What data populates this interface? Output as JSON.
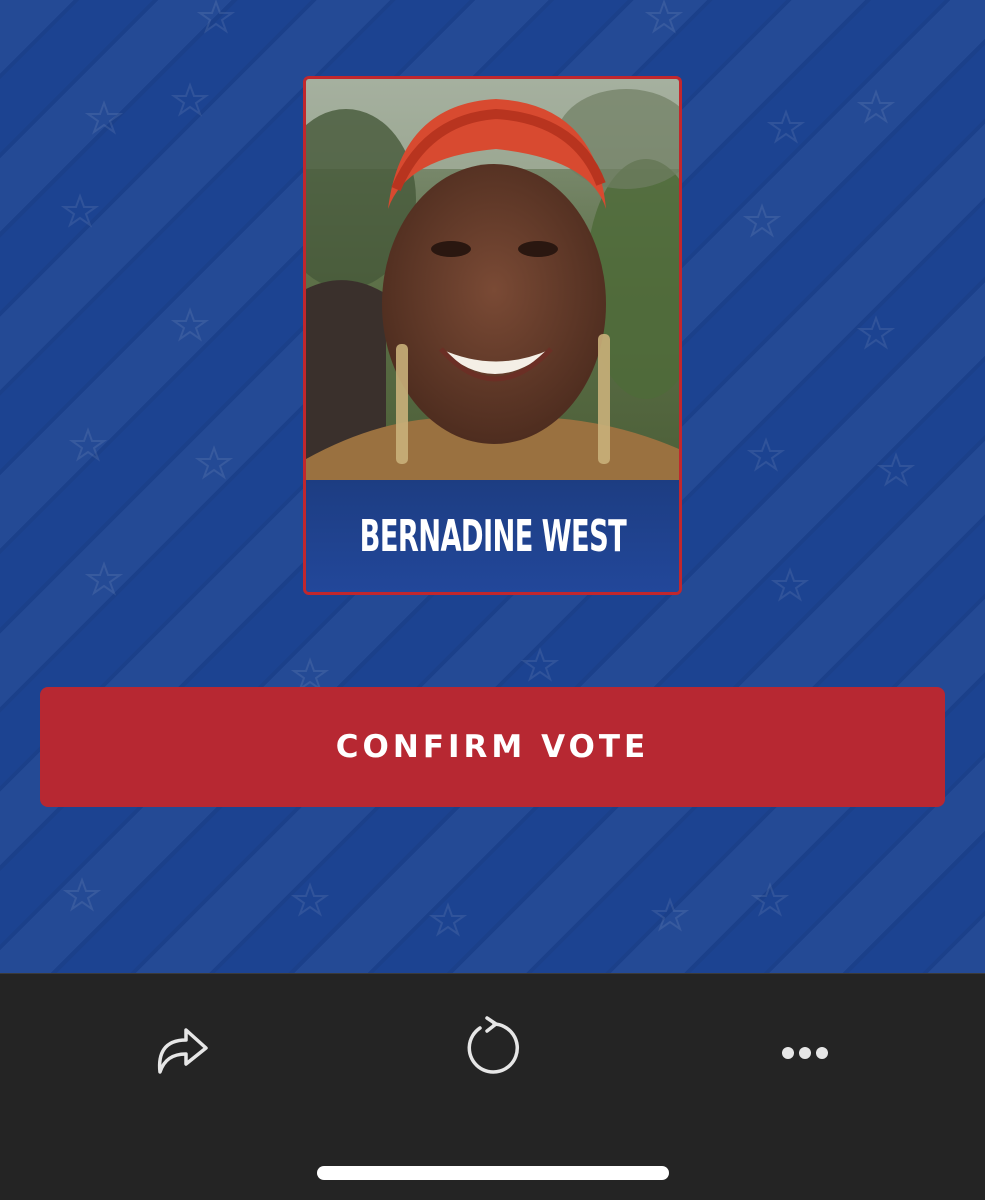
{
  "candidate": {
    "name": "BERNADINE WEST",
    "photo_alt": "BERNADINE WEST"
  },
  "actions": {
    "confirm_label": "CONFIRM VOTE"
  },
  "toolbar": {
    "icons": [
      "share-icon",
      "reload-icon",
      "more-icon"
    ]
  },
  "colors": {
    "background_blue": "#1c4391",
    "accent_red": "#b72832",
    "card_border": "#c1272d",
    "toolbar_bg": "#242424"
  }
}
